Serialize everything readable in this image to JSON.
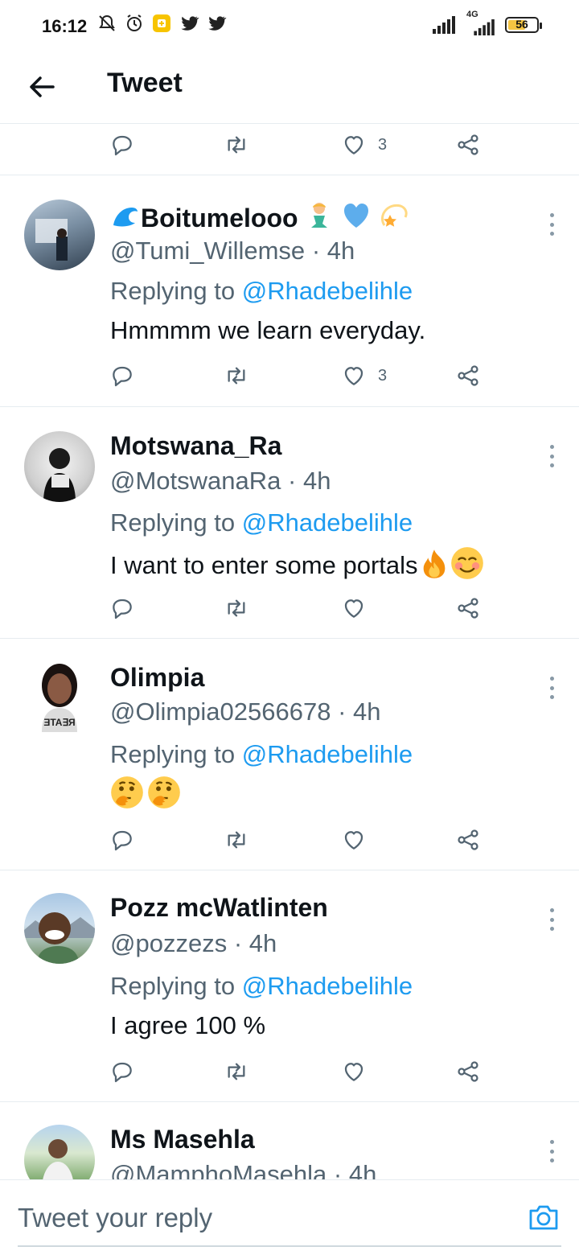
{
  "status_bar": {
    "time": "16:12",
    "network": "4G",
    "battery": "56",
    "icons": [
      "mute-icon",
      "alarm-icon",
      "app-notification-icon",
      "twitter-bird-icon",
      "twitter-bird-icon"
    ]
  },
  "header": {
    "title": "Tweet",
    "back_icon": "arrow-left-icon"
  },
  "top_actions": {
    "like_count": "3"
  },
  "tweets": [
    {
      "name": "Boitumelooo",
      "name_emojis": [
        "wave-emoji",
        "mermaid-emoji",
        "blue-heart-emoji",
        "dizzy-emoji"
      ],
      "handle": "@Tumi_Willemse",
      "time": "· 4h",
      "replying_prefix": "Replying to",
      "replying_to": "@Rhadebelihle",
      "text": "Hmmmm we learn everyday.",
      "like_count": "3"
    },
    {
      "name": "Motswana_Ra",
      "handle": "@MotswanaRa",
      "time": "· 4h",
      "replying_prefix": "Replying to",
      "replying_to": "@Rhadebelihle",
      "text": "I want to enter some portals",
      "text_emojis": [
        "fire-emoji",
        "smiling-face-emoji"
      ],
      "like_count": ""
    },
    {
      "name": "Olimpia",
      "handle": "@Olimpia02566678",
      "time": "· 4h",
      "replying_prefix": "Replying to",
      "replying_to": "@Rhadebelihle",
      "text": "",
      "text_emojis": [
        "thinking-face-emoji",
        "thinking-face-emoji"
      ],
      "like_count": ""
    },
    {
      "name": "Pozz mcWatlinten",
      "handle": "@pozzezs",
      "time": "· 4h",
      "replying_prefix": "Replying to",
      "replying_to": "@Rhadebelihle",
      "text": "I agree 100 %",
      "like_count": ""
    },
    {
      "name": "Ms Masehla",
      "handle": "@MamphoMasehla",
      "time": "· 4h"
    }
  ],
  "composer": {
    "placeholder": "Tweet your reply",
    "camera_icon": "camera-icon"
  },
  "colors": {
    "accent": "#1d9bf0",
    "secondary_text": "#536471",
    "divider": "#e6ecf0"
  }
}
